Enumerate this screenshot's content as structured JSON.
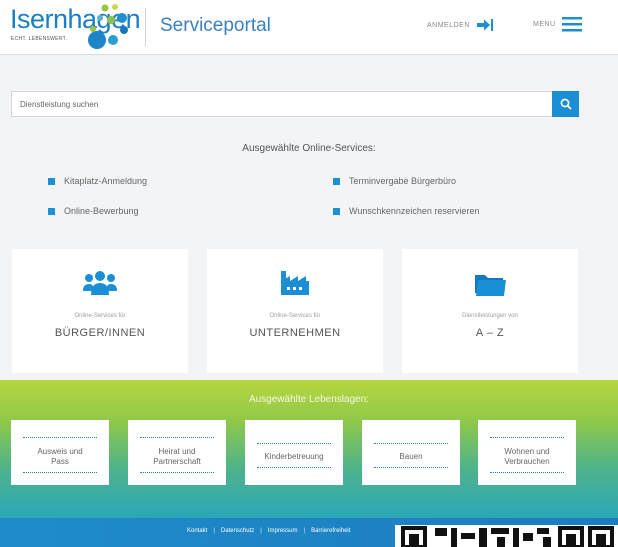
{
  "header": {
    "logo_text": "Isernhagen",
    "logo_tagline": "ECHT. LEBENSWERT.",
    "portal_title": "Serviceportal",
    "login_label": "ANMELDEN",
    "menu_label": "MENU"
  },
  "search": {
    "placeholder": "Dienstleistung suchen"
  },
  "online_services": {
    "title": "Ausgewählte Online-Services:",
    "links": [
      "Kitaplatz-Anmeldung",
      "Terminvergabe Bürgerbüro",
      "Online-Bewerbung",
      "Wunschkennzeichen reservieren"
    ]
  },
  "cards": [
    {
      "small": "Online-Services für",
      "big": "BÜRGER/INNEN",
      "icon": "people-icon"
    },
    {
      "small": "Online-Services für",
      "big": "UNTERNEHMEN",
      "icon": "factory-icon"
    },
    {
      "small": "Dienstleistungen von",
      "big": "A – Z",
      "icon": "folder-icon"
    }
  ],
  "lebenslagen": {
    "title": "Ausgewählte Lebenslagen:",
    "tiles": [
      {
        "line1": "Ausweis und",
        "line2": "Pass"
      },
      {
        "line1": "Heirat und",
        "line2": "Partnerschaft"
      },
      {
        "line1": "Kinderbetreuung",
        "line2": ""
      },
      {
        "line1": "Bauen",
        "line2": ""
      },
      {
        "line1": "Wohnen und",
        "line2": "Verbrauchen"
      }
    ]
  },
  "footer": {
    "links": [
      "Kontakt",
      "Datenschutz",
      "Impressum",
      "Barrierefreiheit"
    ],
    "separator": "|"
  },
  "colors": {
    "brand_blue": "#1a8fd6",
    "logo_blue": "#1a7fc6",
    "gradient_top": "#b7d63e",
    "gradient_bottom": "#2aa7b9"
  }
}
